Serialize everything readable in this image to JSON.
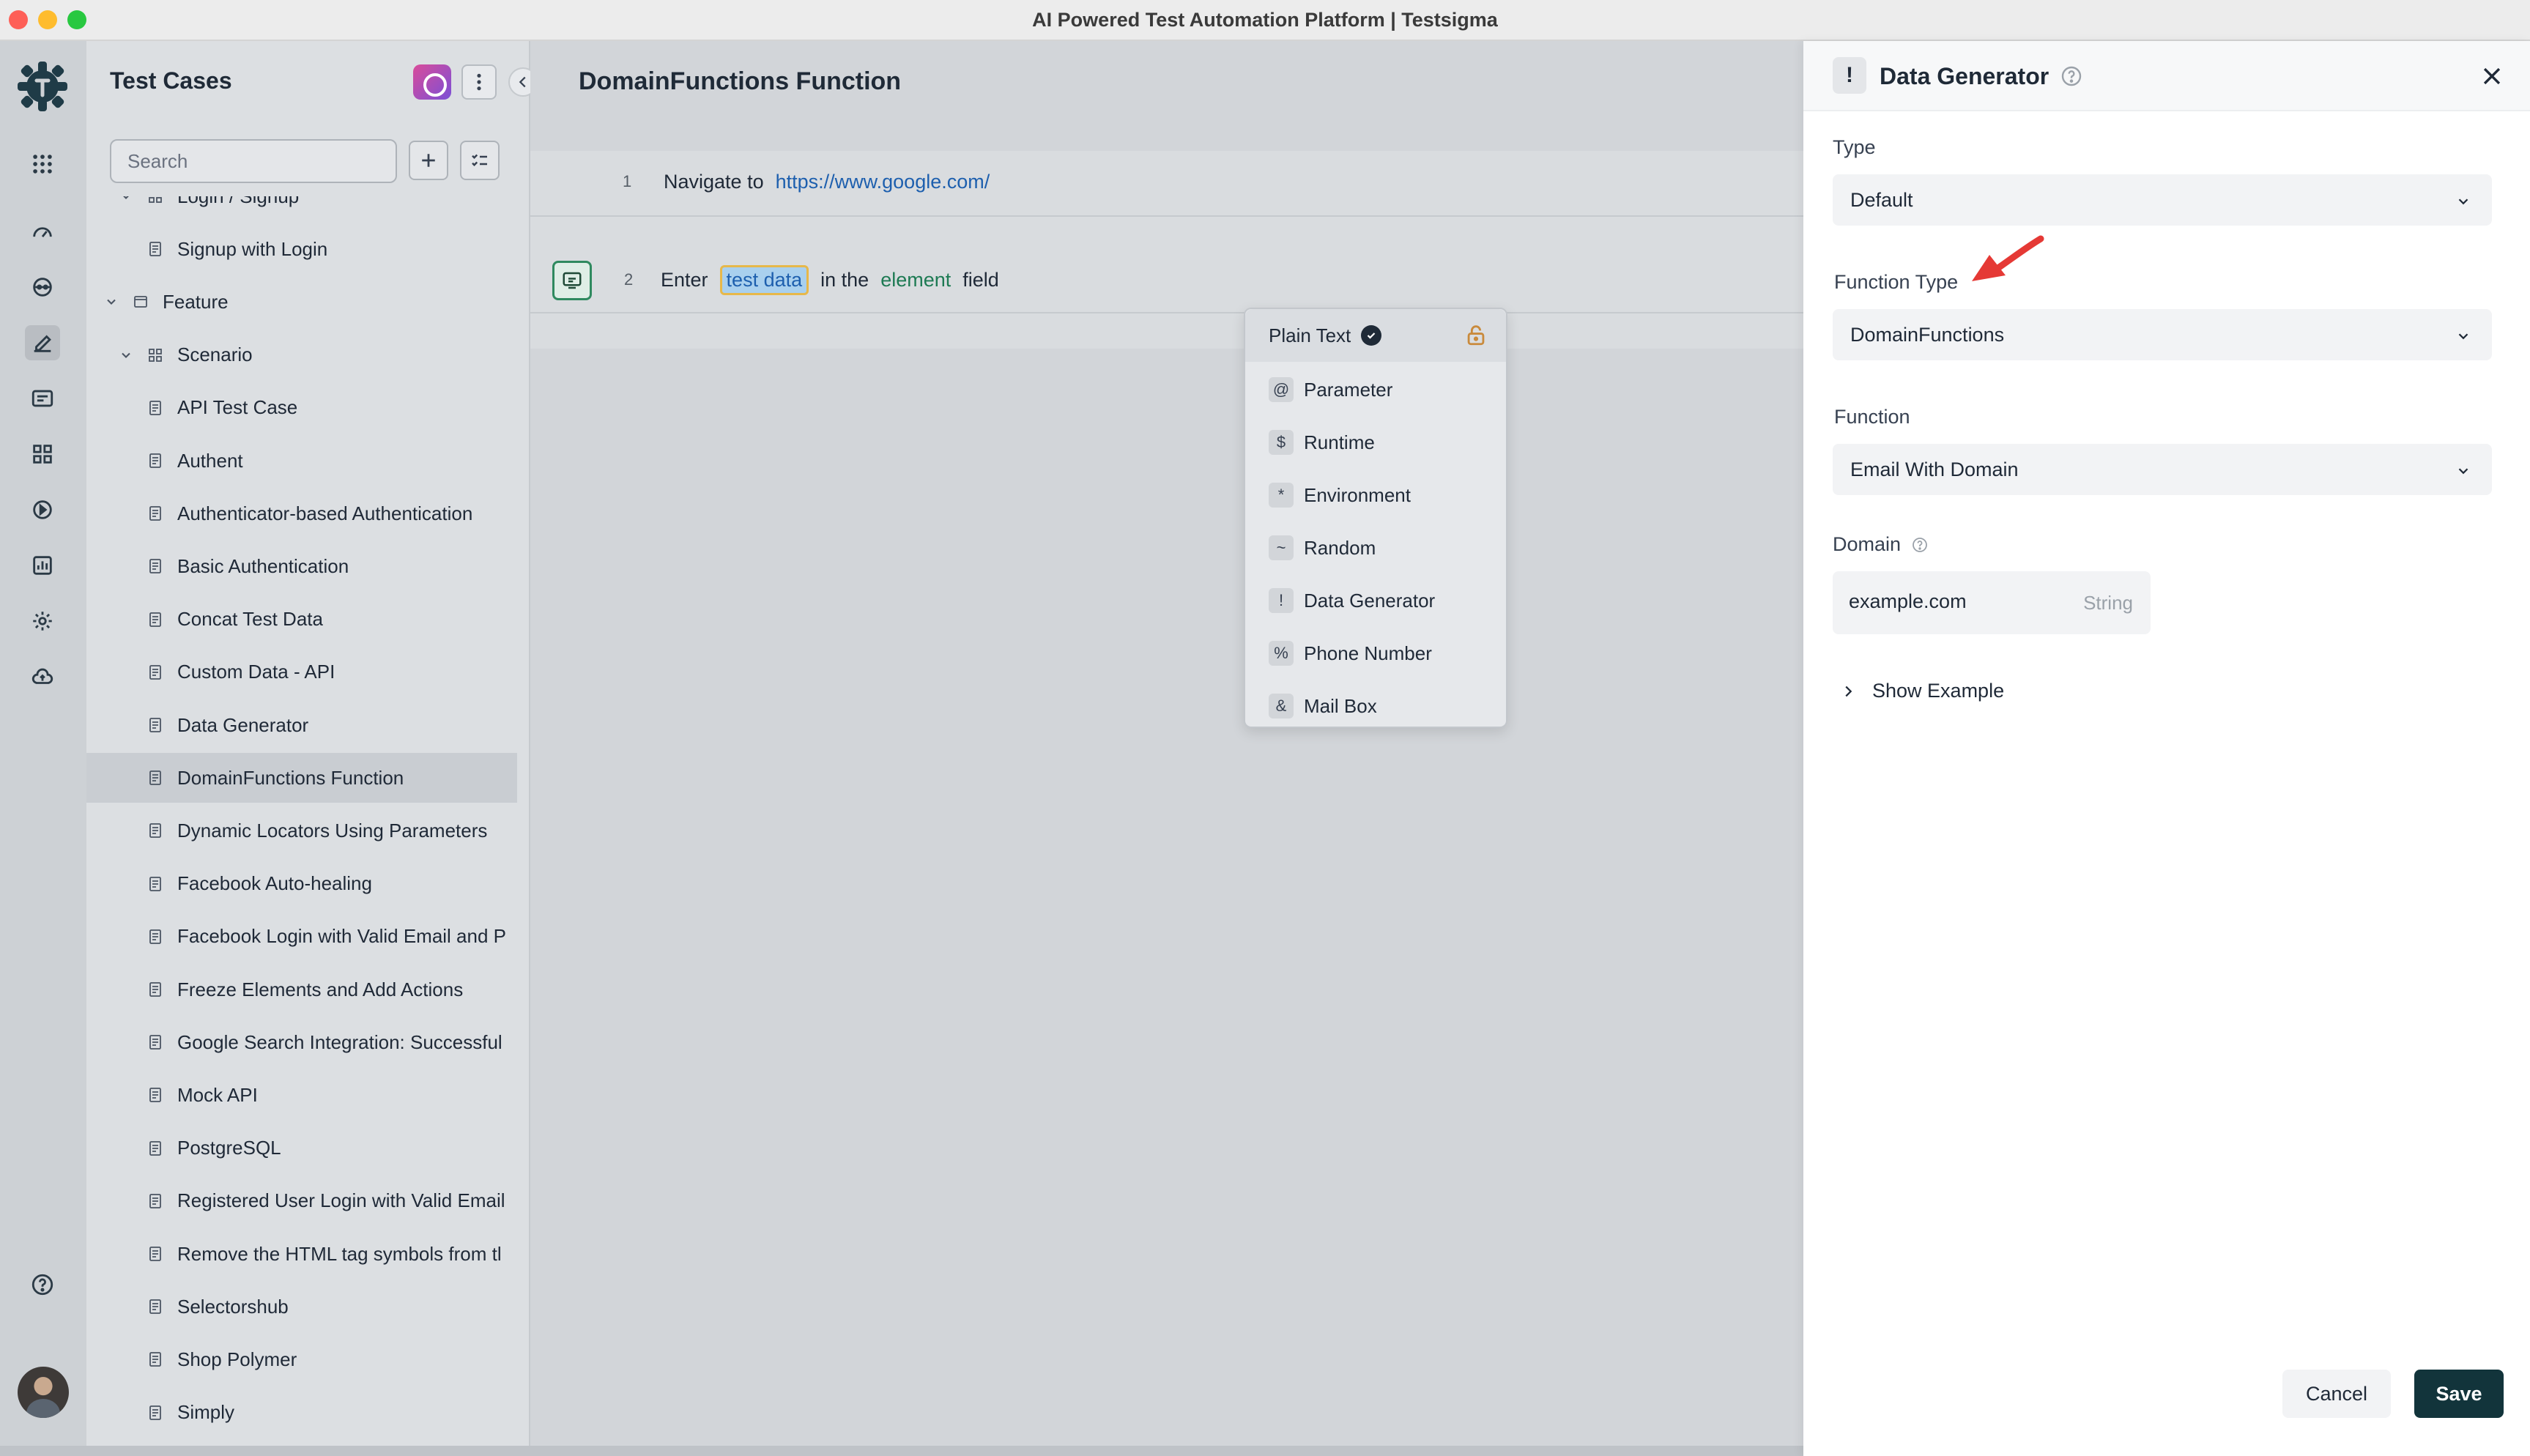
{
  "window": {
    "title": "AI Powered Test Automation Platform | Testsigma"
  },
  "rail": {
    "icons": [
      "apps-grid-icon",
      "dashboard-gauge-icon",
      "agent-icon",
      "edit-pencil-icon",
      "folder-icon",
      "modules-icon",
      "run-icon",
      "reports-icon",
      "settings-gear-icon",
      "cloud-upload-icon",
      "help-icon"
    ]
  },
  "tree": {
    "title": "Test Cases",
    "search_placeholder": "Search",
    "items": [
      {
        "label": "Login / Signup",
        "kind": "scenario",
        "level": 1
      },
      {
        "label": "Signup with Login",
        "kind": "case",
        "level": 2
      },
      {
        "label": "Feature",
        "kind": "feature",
        "level": 0
      },
      {
        "label": "Scenario",
        "kind": "scenario",
        "level": 1
      },
      {
        "label": "API Test Case",
        "kind": "case",
        "level": 2
      },
      {
        "label": "Authent",
        "kind": "case",
        "level": 2
      },
      {
        "label": "Authenticator-based Authentication",
        "kind": "case",
        "level": 2
      },
      {
        "label": "Basic Authentication",
        "kind": "case",
        "level": 2
      },
      {
        "label": "Concat Test Data",
        "kind": "case",
        "level": 2
      },
      {
        "label": "Custom Data - API",
        "kind": "case",
        "level": 2
      },
      {
        "label": "Data Generator",
        "kind": "case",
        "level": 2
      },
      {
        "label": "DomainFunctions Function",
        "kind": "case",
        "level": 2,
        "selected": true
      },
      {
        "label": "Dynamic Locators Using Parameters",
        "kind": "case",
        "level": 2
      },
      {
        "label": "Facebook Auto-healing",
        "kind": "case",
        "level": 2
      },
      {
        "label": "Facebook Login with Valid Email and P",
        "kind": "case",
        "level": 2
      },
      {
        "label": "Freeze Elements and Add Actions",
        "kind": "case",
        "level": 2
      },
      {
        "label": "Google Search Integration: Successful",
        "kind": "case",
        "level": 2
      },
      {
        "label": "Mock API",
        "kind": "case",
        "level": 2
      },
      {
        "label": "PostgreSQL",
        "kind": "case",
        "level": 2
      },
      {
        "label": "Registered User Login with Valid Email",
        "kind": "case",
        "level": 2
      },
      {
        "label": "Remove the HTML tag symbols from tl",
        "kind": "case",
        "level": 2
      },
      {
        "label": "Selectorshub",
        "kind": "case",
        "level": 2
      },
      {
        "label": "Shop Polymer",
        "kind": "case",
        "level": 2
      },
      {
        "label": "Simply",
        "kind": "case",
        "level": 2
      }
    ]
  },
  "editor": {
    "title": "DomainFunctions Function",
    "steps": [
      {
        "num": "1",
        "action": "Navigate to",
        "url": "https://www.google.com/"
      },
      {
        "num": "2",
        "action": "Enter",
        "data": "test data",
        "mid": "in the",
        "element": "element",
        "tail": "field"
      }
    ],
    "data_types": [
      {
        "symbol": "",
        "label": "Plain Text",
        "selected": true
      },
      {
        "symbol": "@",
        "label": "Parameter"
      },
      {
        "symbol": "$",
        "label": "Runtime"
      },
      {
        "symbol": "*",
        "label": "Environment"
      },
      {
        "symbol": "~",
        "label": "Random"
      },
      {
        "symbol": "!",
        "label": "Data Generator"
      },
      {
        "symbol": "%",
        "label": "Phone Number"
      },
      {
        "symbol": "&",
        "label": "Mail Box"
      }
    ]
  },
  "drawer": {
    "badge": "!",
    "title": "Data Generator",
    "type_label": "Type",
    "type_value": "Default",
    "function_type_label": "Function Type",
    "function_type_value": "DomainFunctions",
    "function_label": "Function",
    "function_value": "Email With Domain",
    "domain_label": "Domain",
    "domain_value": "example.com",
    "domain_type": "String",
    "show_example": "Show Example",
    "cancel": "Cancel",
    "save": "Save"
  },
  "colors": {
    "accent_dark": "#12343b",
    "link": "#1d5fae",
    "element_token": "#1d7a53",
    "annotation_arrow": "#e53935"
  }
}
